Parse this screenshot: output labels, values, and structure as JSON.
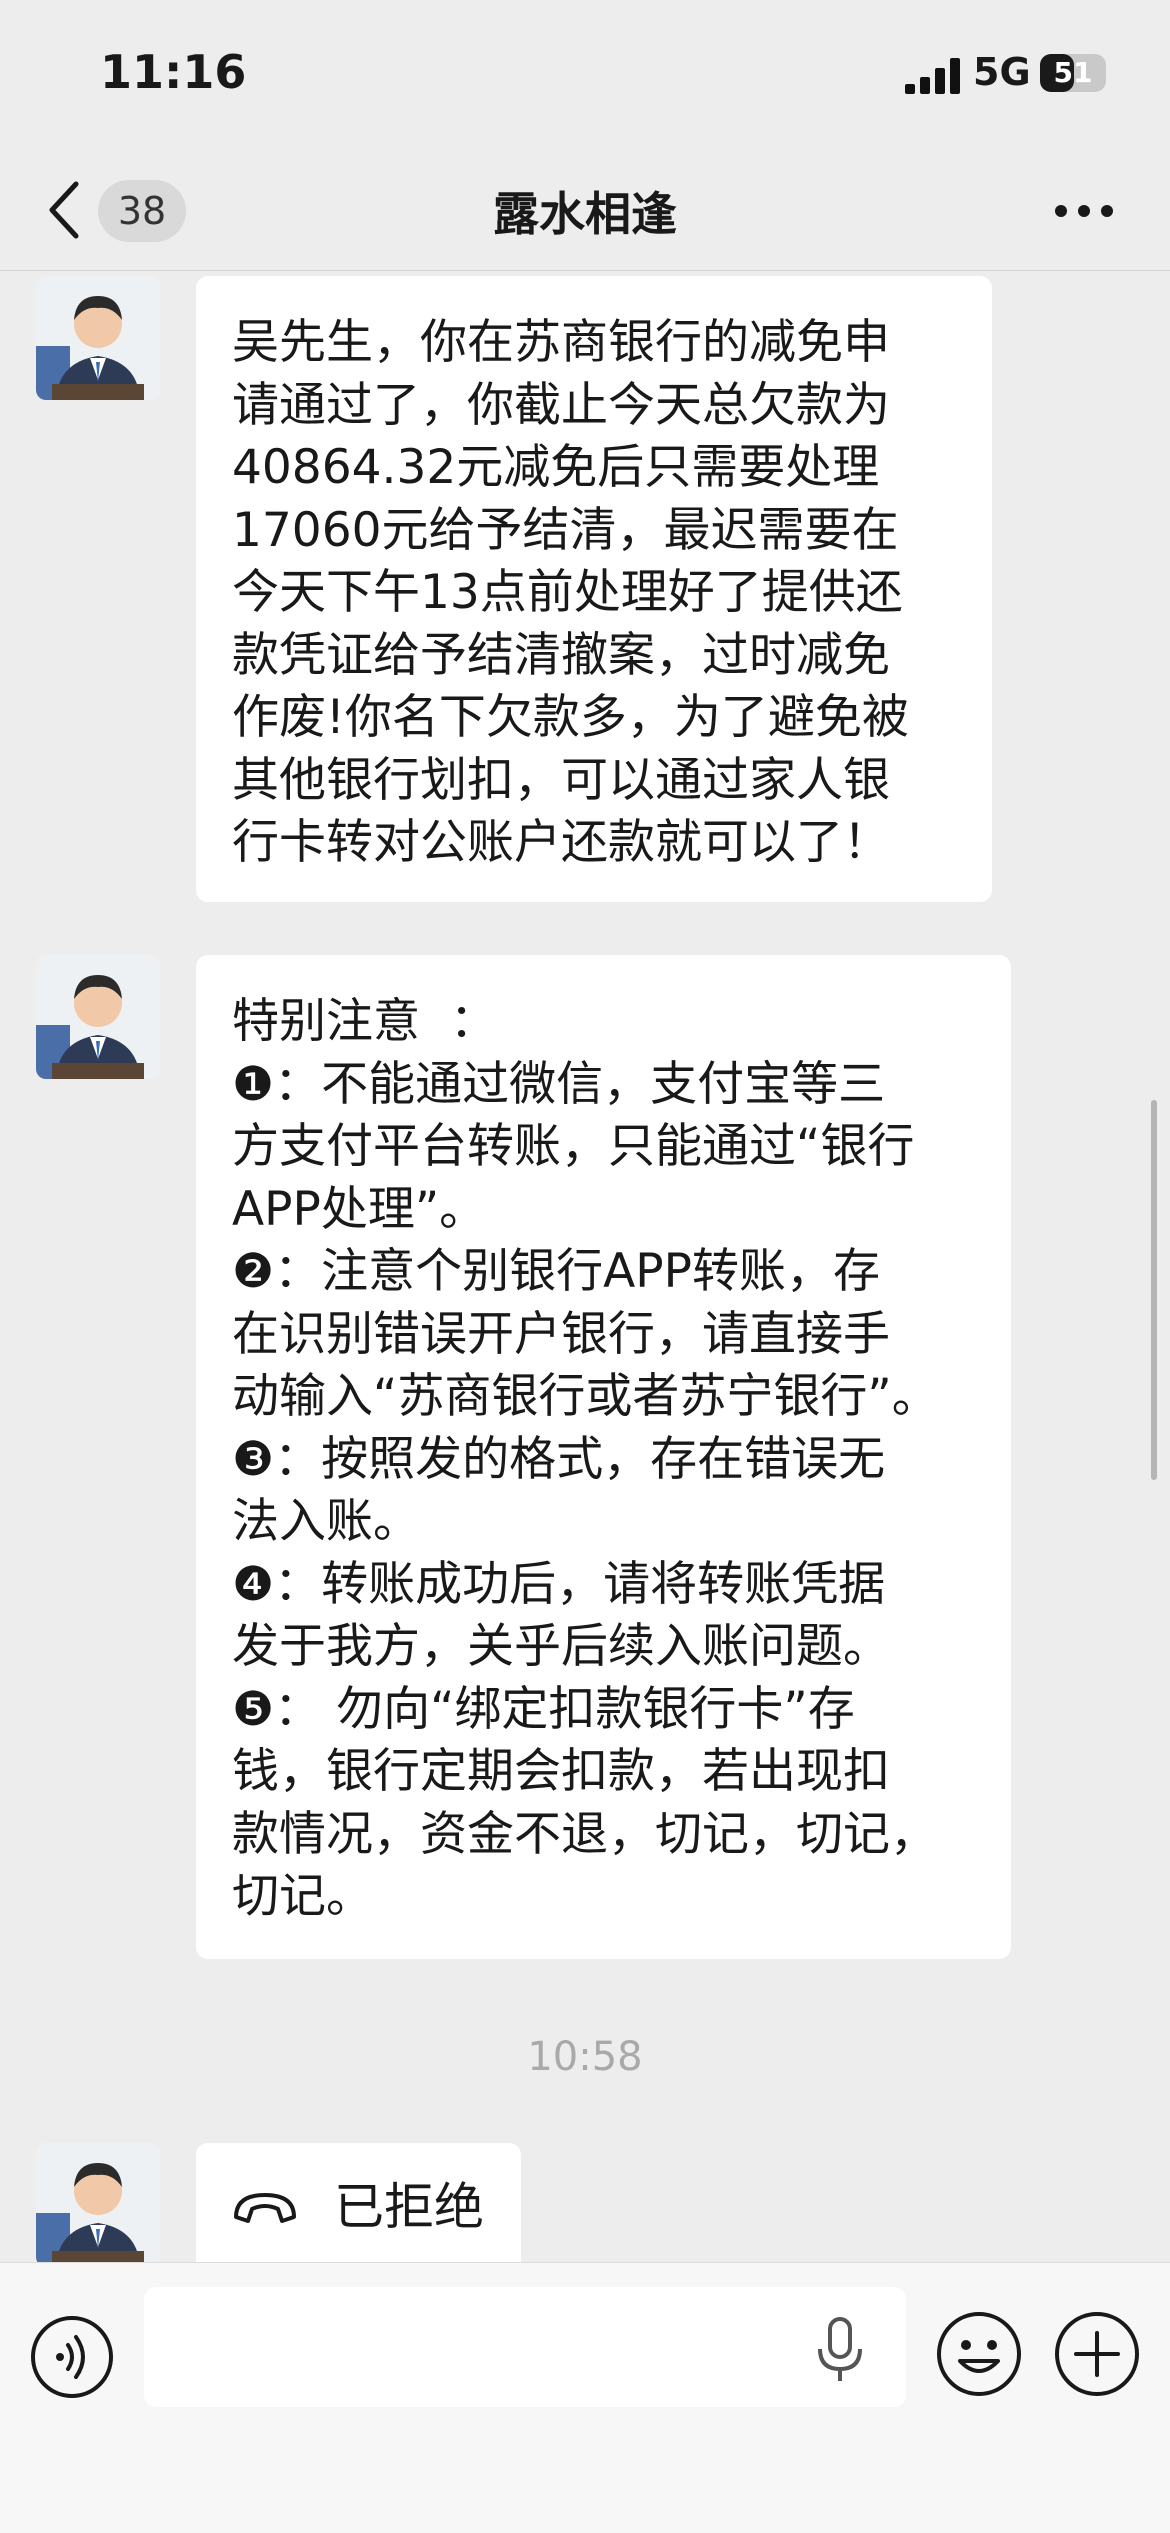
{
  "status_bar": {
    "time": "11:16",
    "network": "5G",
    "battery": "51",
    "battery_level_percent": 51
  },
  "nav": {
    "unread_count": "38",
    "title": "露水相逢"
  },
  "messages": [
    {
      "type": "text",
      "text": "吴先生，你在苏商银行的减免申\n请通过了，你截止今天总欠款为\n40864.32元减免后只需要处理\n17060元给予结清，最迟需要在\n今天下午13点前处理好了提供还\n款凭证给予结清撤案，过时减免\n作废!你名下欠款多，为了避免被\n其他银行划扣，可以通过家人银\n行卡转对公账户还款就可以了！"
    },
    {
      "type": "text",
      "text": "特别注意  ：\n❶：不能通过微信，支付宝等三\n方支付平台转账，只能通过“银行\nAPP处理”。\n❷：注意个别银行APP转账，存\n在识别错误开户银行，请直接手\n动输入“苏商银行或者苏宁银行”。\n❸：按照发的格式，存在错误无\n法入账。\n❹：转账成功后，请将转账凭据\n发于我方，关乎后续入账问题。\n❺： 勿向“绑定扣款银行卡”存\n钱，银行定期会扣款，若出现扣\n款情况，资金不退，切记，切记，\n切记。"
    },
    {
      "type": "call",
      "text": "已拒绝"
    }
  ],
  "timestamp": "10:58",
  "input": {
    "value": "",
    "placeholder": ""
  },
  "colors": {
    "background": "#ededed",
    "bubble": "#ffffff",
    "timestamp": "#a9a9a9"
  },
  "icons": [
    "back-icon",
    "more-icon",
    "call-declined-icon",
    "voice-icon",
    "mic-icon",
    "emoji-icon",
    "plus-icon"
  ]
}
